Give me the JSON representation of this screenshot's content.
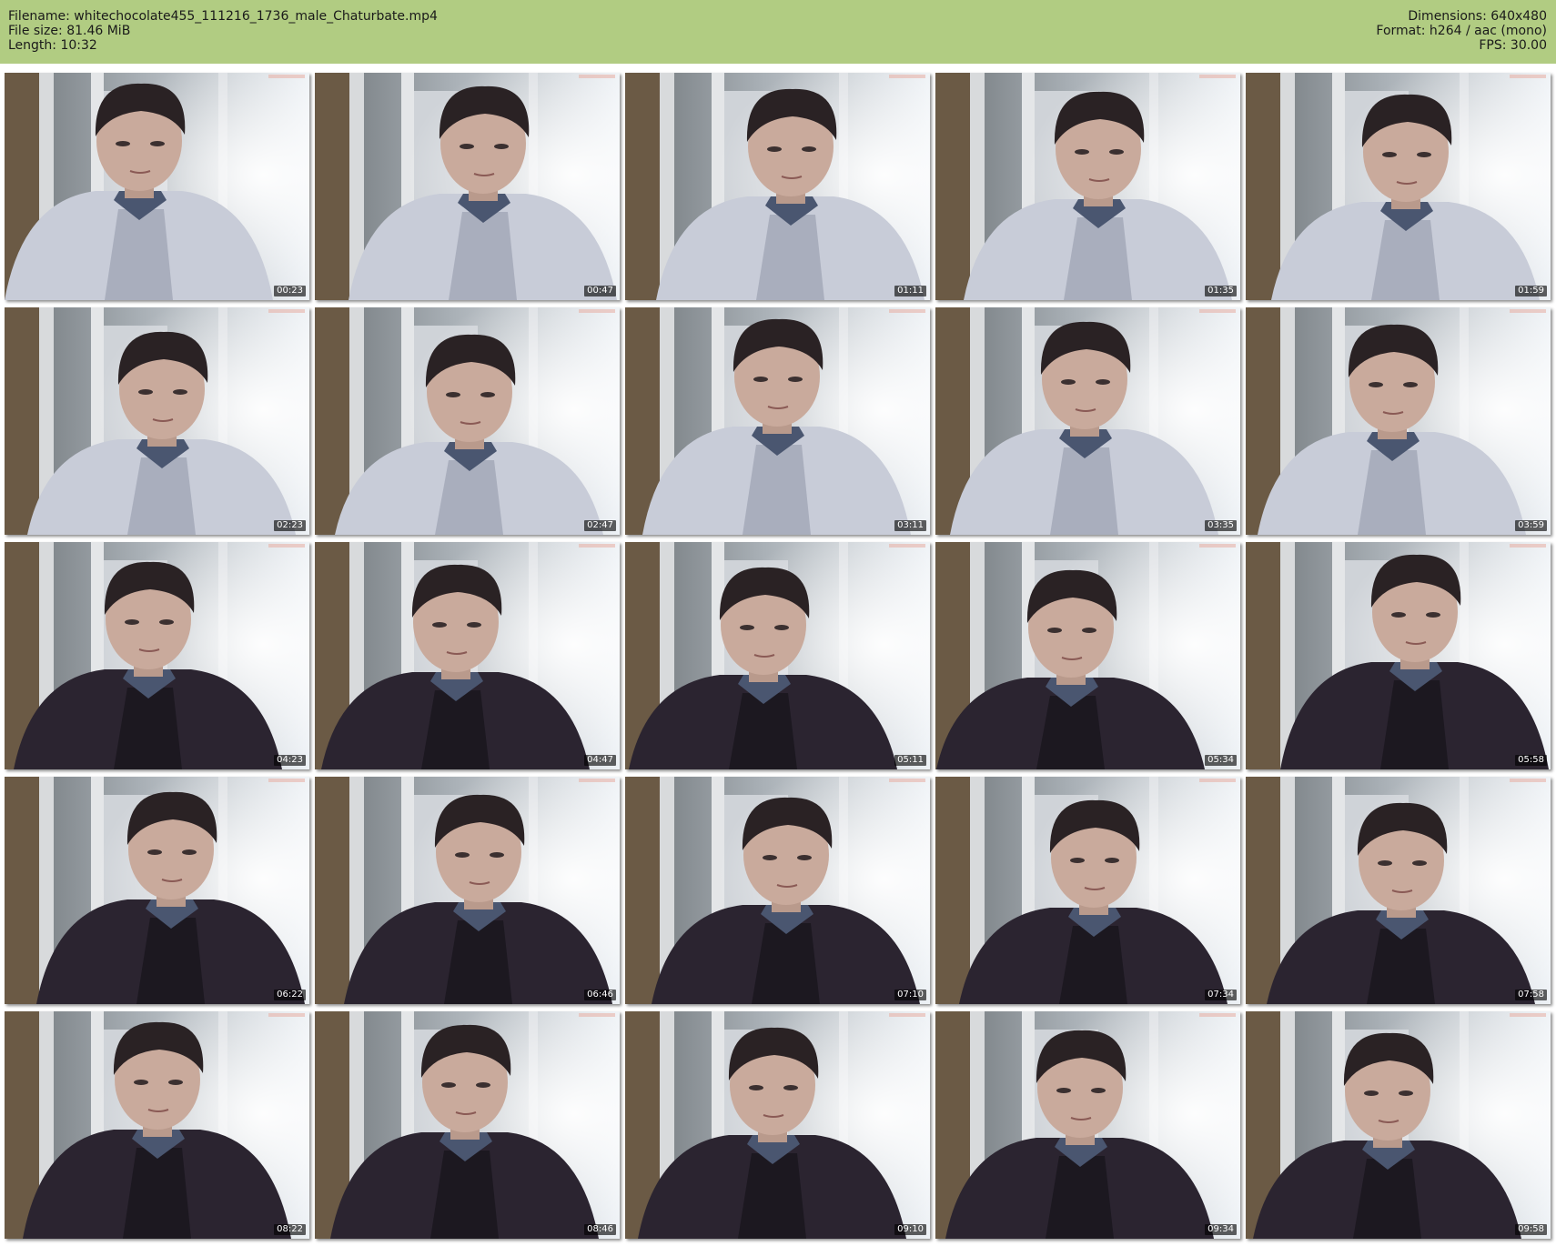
{
  "header": {
    "filename_line": "Filename: whitechocolate455_111216_1736_male_Chaturbate.mp4",
    "filesize_line": "File size: 81.46 MiB",
    "length_line": "Length: 10:32",
    "dimensions_line": "Dimensions: 640x480",
    "format_line": "Format: h264 / aac (mono)",
    "fps_line": "FPS: 30.00"
  },
  "colors": {
    "header_background": "#b1cc82",
    "timestamp_background": "#000000"
  },
  "thumbnails": [
    {
      "timestamp": "00:23",
      "clothing": "hoodie"
    },
    {
      "timestamp": "00:47",
      "clothing": "hoodie"
    },
    {
      "timestamp": "01:11",
      "clothing": "hoodie"
    },
    {
      "timestamp": "01:35",
      "clothing": "hoodie"
    },
    {
      "timestamp": "01:59",
      "clothing": "hoodie"
    },
    {
      "timestamp": "02:23",
      "clothing": "hoodie"
    },
    {
      "timestamp": "02:47",
      "clothing": "hoodie"
    },
    {
      "timestamp": "03:11",
      "clothing": "hoodie"
    },
    {
      "timestamp": "03:35",
      "clothing": "hoodie"
    },
    {
      "timestamp": "03:59",
      "clothing": "hoodie"
    },
    {
      "timestamp": "04:23",
      "clothing": "sweater"
    },
    {
      "timestamp": "04:47",
      "clothing": "sweater"
    },
    {
      "timestamp": "05:11",
      "clothing": "sweater"
    },
    {
      "timestamp": "05:34",
      "clothing": "sweater"
    },
    {
      "timestamp": "05:58",
      "clothing": "sweater"
    },
    {
      "timestamp": "06:22",
      "clothing": "sweater"
    },
    {
      "timestamp": "06:46",
      "clothing": "sweater"
    },
    {
      "timestamp": "07:10",
      "clothing": "sweater"
    },
    {
      "timestamp": "07:34",
      "clothing": "sweater"
    },
    {
      "timestamp": "07:58",
      "clothing": "sweater"
    },
    {
      "timestamp": "08:22",
      "clothing": "sweater"
    },
    {
      "timestamp": "08:46",
      "clothing": "sweater"
    },
    {
      "timestamp": "09:10",
      "clothing": "sweater"
    },
    {
      "timestamp": "09:34",
      "clothing": "sweater"
    },
    {
      "timestamp": "09:58",
      "clothing": "sweater"
    }
  ]
}
